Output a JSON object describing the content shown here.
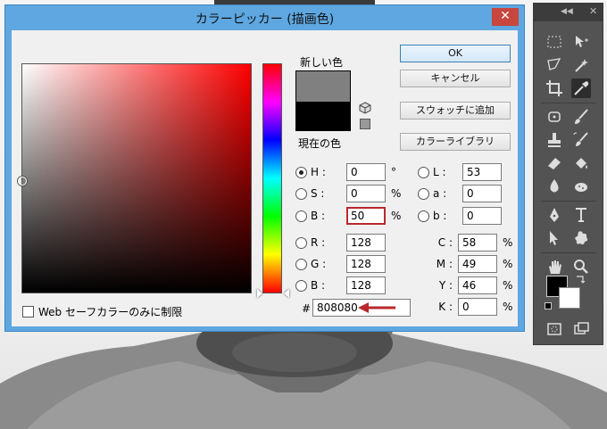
{
  "window": {
    "title": "カラーピッカー (描画色)",
    "close_glyph": "✕"
  },
  "swatch": {
    "new_label": "新しい色",
    "current_label": "現在の色",
    "new_color": "#808080",
    "current_color": "#000000"
  },
  "buttons": {
    "ok": "OK",
    "cancel": "キャンセル",
    "add_swatch": "スウォッチに追加",
    "color_library": "カラーライブラリ"
  },
  "hsb": [
    {
      "label": "H :",
      "value": "0",
      "unit": "°",
      "selected": true
    },
    {
      "label": "S :",
      "value": "0",
      "unit": "%",
      "selected": false
    },
    {
      "label": "B :",
      "value": "50",
      "unit": "%",
      "selected": false
    }
  ],
  "rgb": [
    {
      "label": "R :",
      "value": "128"
    },
    {
      "label": "G :",
      "value": "128"
    },
    {
      "label": "B :",
      "value": "128"
    }
  ],
  "lab": [
    {
      "label": "L :",
      "value": "53"
    },
    {
      "label": "a :",
      "value": "0"
    },
    {
      "label": "b :",
      "value": "0"
    }
  ],
  "cmyk": [
    {
      "label": "C :",
      "value": "58",
      "unit": "%"
    },
    {
      "label": "M :",
      "value": "49",
      "unit": "%"
    },
    {
      "label": "Y :",
      "value": "46",
      "unit": "%"
    },
    {
      "label": "K :",
      "value": "0",
      "unit": "%"
    }
  ],
  "hex": {
    "label": "#",
    "value": "808080"
  },
  "websafe": {
    "label": "Web セーフカラーのみに制限"
  },
  "tools_panel": {
    "collapse_glyph": "◀◀",
    "close_glyph": "✕",
    "foreground_color": "#000000",
    "background_color": "#ffffff"
  },
  "colors": {
    "title_bar": "#5ea7e0",
    "close_button": "#c7463d",
    "active_field_border": "#b8282c",
    "annotation_arrow": "#b8282c"
  }
}
